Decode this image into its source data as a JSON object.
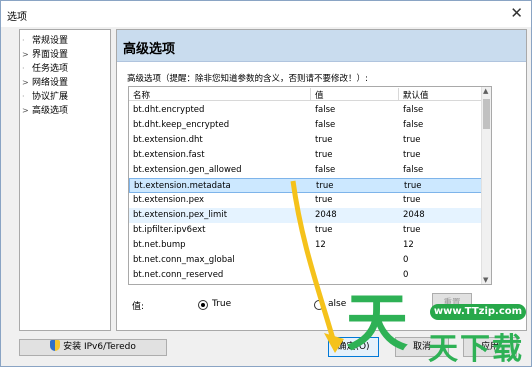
{
  "window": {
    "title": "选项",
    "close_glyph": "✕"
  },
  "tree": [
    {
      "label": "常规设置",
      "expander": ""
    },
    {
      "label": "界面设置",
      "expander": ">"
    },
    {
      "label": "任务选项",
      "expander": ""
    },
    {
      "label": "网络设置",
      "expander": ">"
    },
    {
      "label": "协议扩展",
      "expander": ""
    },
    {
      "label": "高级选项",
      "expander": ">"
    }
  ],
  "panel": {
    "header": "高级选项",
    "hint": "高级选项（提醒：除非您知道参数的含义，否则请不要修改！）:"
  },
  "grid": {
    "columns": [
      "名称",
      "值",
      "默认值"
    ],
    "rows": [
      {
        "name": "bt.dht.encrypted",
        "value": "false",
        "default": "false"
      },
      {
        "name": "bt.dht.keep_encrypted",
        "value": "false",
        "default": "false"
      },
      {
        "name": "bt.extension.dht",
        "value": "true",
        "default": "true"
      },
      {
        "name": "bt.extension.fast",
        "value": "true",
        "default": "true"
      },
      {
        "name": "bt.extension.gen_allowed",
        "value": "false",
        "default": "false"
      },
      {
        "name": "bt.extension.metadata",
        "value": "true",
        "default": "true"
      },
      {
        "name": "bt.extension.pex",
        "value": "true",
        "default": "true"
      },
      {
        "name": "bt.extension.pex_limit",
        "value": "2048",
        "default": "2048"
      },
      {
        "name": "bt.ipfilter.ipv6ext",
        "value": "true",
        "default": "true"
      },
      {
        "name": "bt.net.bump",
        "value": "12",
        "default": "12"
      },
      {
        "name": "bt.net.conn_max_global",
        "value": "",
        "default": "0"
      },
      {
        "name": "bt.net.conn_reserved",
        "value": "",
        "default": "0"
      }
    ]
  },
  "value_editor": {
    "label": "值:",
    "true_label": "True",
    "false_label": "alse",
    "restore_label": "重置"
  },
  "buttons": {
    "ipv6": "安装 IPv6/Teredo",
    "ok": "确定(O)",
    "cancel": "取消",
    "apply": "应用"
  },
  "watermark": {
    "logo": "天",
    "url": "www.TTzip.com",
    "text": "天下载"
  },
  "colors": {
    "header_bg": "#c9dcee",
    "selected_row": "#cce8ff",
    "watermark_green": "#2eb155"
  }
}
